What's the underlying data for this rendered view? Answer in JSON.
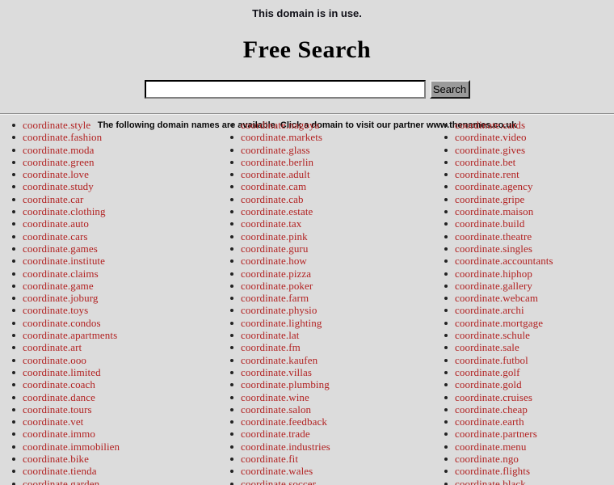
{
  "header": {
    "tagline": "This domain is in use.",
    "title": "Free Search"
  },
  "search": {
    "value": "",
    "placeholder": "",
    "button_label": "Search"
  },
  "notice": "The following domain names are available. Click a domain to visit our partner www.thenames.co.uk",
  "colors": {
    "background": "#dcdcdc",
    "link": "#b22222",
    "text": "#000000",
    "button_face": "#9a9a9a"
  },
  "columns": [
    {
      "id": "column-1",
      "items": [
        "coordinate.style",
        "coordinate.fashion",
        "coordinate.moda",
        "coordinate.green",
        "coordinate.love",
        "coordinate.study",
        "coordinate.car",
        "coordinate.clothing",
        "coordinate.auto",
        "coordinate.cars",
        "coordinate.games",
        "coordinate.institute",
        "coordinate.claims",
        "coordinate.game",
        "coordinate.joburg",
        "coordinate.toys",
        "coordinate.condos",
        "coordinate.apartments",
        "coordinate.art",
        "coordinate.ooo",
        "coordinate.limited",
        "coordinate.coach",
        "coordinate.dance",
        "coordinate.tours",
        "coordinate.vet",
        "coordinate.immo",
        "coordinate.immobilien",
        "coordinate.bike",
        "coordinate.tienda",
        "coordinate.garden"
      ]
    },
    {
      "id": "column-2",
      "items": [
        "coordinate.nagoya",
        "coordinate.markets",
        "coordinate.glass",
        "coordinate.berlin",
        "coordinate.adult",
        "coordinate.cam",
        "coordinate.cab",
        "coordinate.estate",
        "coordinate.tax",
        "coordinate.pink",
        "coordinate.guru",
        "coordinate.how",
        "coordinate.pizza",
        "coordinate.poker",
        "coordinate.farm",
        "coordinate.physio",
        "coordinate.lighting",
        "coordinate.lat",
        "coordinate.fm",
        "coordinate.kaufen",
        "coordinate.villas",
        "coordinate.plumbing",
        "coordinate.wine",
        "coordinate.salon",
        "coordinate.feedback",
        "coordinate.trade",
        "coordinate.industries",
        "coordinate.fit",
        "coordinate.wales",
        "coordinate.soccer"
      ]
    },
    {
      "id": "column-3",
      "items": [
        "coordinate.cards",
        "coordinate.video",
        "coordinate.gives",
        "coordinate.bet",
        "coordinate.rent",
        "coordinate.agency",
        "coordinate.gripe",
        "coordinate.maison",
        "coordinate.build",
        "coordinate.theatre",
        "coordinate.singles",
        "coordinate.accountants",
        "coordinate.hiphop",
        "coordinate.gallery",
        "coordinate.webcam",
        "coordinate.archi",
        "coordinate.mortgage",
        "coordinate.schule",
        "coordinate.sale",
        "coordinate.futbol",
        "coordinate.golf",
        "coordinate.gold",
        "coordinate.cruises",
        "coordinate.cheap",
        "coordinate.earth",
        "coordinate.partners",
        "coordinate.menu",
        "coordinate.ngo",
        "coordinate.flights",
        "coordinate.black"
      ]
    }
  ]
}
